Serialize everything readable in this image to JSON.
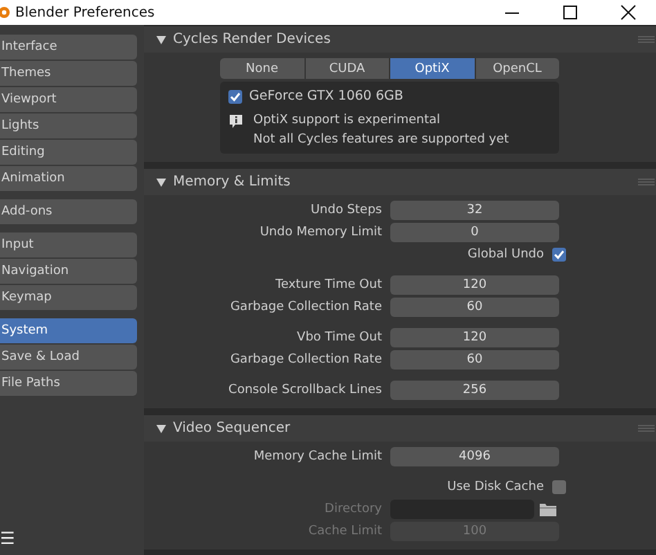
{
  "window": {
    "title": "Blender Preferences"
  },
  "sidebar": {
    "groups": [
      [
        {
          "label": "Interface",
          "selected": false
        },
        {
          "label": "Themes",
          "selected": false
        },
        {
          "label": "Viewport",
          "selected": false
        },
        {
          "label": "Lights",
          "selected": false
        },
        {
          "label": "Editing",
          "selected": false
        },
        {
          "label": "Animation",
          "selected": false
        }
      ],
      [
        {
          "label": "Add-ons",
          "selected": false
        }
      ],
      [
        {
          "label": "Input",
          "selected": false
        },
        {
          "label": "Navigation",
          "selected": false
        },
        {
          "label": "Keymap",
          "selected": false
        }
      ],
      [
        {
          "label": "System",
          "selected": true
        },
        {
          "label": "Save & Load",
          "selected": false
        },
        {
          "label": "File Paths",
          "selected": false
        }
      ]
    ],
    "menu_glyph": "☰"
  },
  "sections": [
    {
      "title": "Cycles Render Devices",
      "expanded": true,
      "groups": [
        [
          {
            "kind": "tabs",
            "options": [
              {
                "label": "None",
                "selected": false
              },
              {
                "label": "CUDA",
                "selected": false
              },
              {
                "label": "OptiX",
                "selected": true
              },
              {
                "label": "OpenCL",
                "selected": false
              }
            ]
          },
          {
            "kind": "devices",
            "devices": [
              {
                "label": "GeForce GTX 1060 6GB",
                "checked": true
              }
            ],
            "info": [
              "OptiX support is experimental",
              "Not all Cycles features are supported yet"
            ]
          }
        ]
      ]
    },
    {
      "title": "Memory & Limits",
      "expanded": true,
      "groups": [
        [
          {
            "kind": "number",
            "label": "Undo Steps",
            "value": "32",
            "disabled": false
          },
          {
            "kind": "number",
            "label": "Undo Memory Limit",
            "value": "0",
            "disabled": false
          },
          {
            "kind": "checkbox",
            "label": "Global Undo",
            "checked": true,
            "disabled": false
          }
        ],
        [
          {
            "kind": "number",
            "label": "Texture Time Out",
            "value": "120",
            "disabled": false
          },
          {
            "kind": "number",
            "label": "Garbage Collection Rate",
            "value": "60",
            "disabled": false
          }
        ],
        [
          {
            "kind": "number",
            "label": "Vbo Time Out",
            "value": "120",
            "disabled": false
          },
          {
            "kind": "number",
            "label": "Garbage Collection Rate",
            "value": "60",
            "disabled": false
          }
        ],
        [
          {
            "kind": "number",
            "label": "Console Scrollback Lines",
            "value": "256",
            "disabled": false
          }
        ]
      ]
    },
    {
      "title": "Video Sequencer",
      "expanded": true,
      "groups": [
        [
          {
            "kind": "number",
            "label": "Memory Cache Limit",
            "value": "4096",
            "disabled": false
          }
        ],
        [
          {
            "kind": "checkbox",
            "label": "Use Disk Cache",
            "checked": false,
            "disabled": false
          },
          {
            "kind": "path",
            "label": "Directory",
            "disabled": true
          },
          {
            "kind": "number",
            "label": "Cache Limit",
            "value": "100",
            "disabled": true
          }
        ]
      ]
    }
  ]
}
